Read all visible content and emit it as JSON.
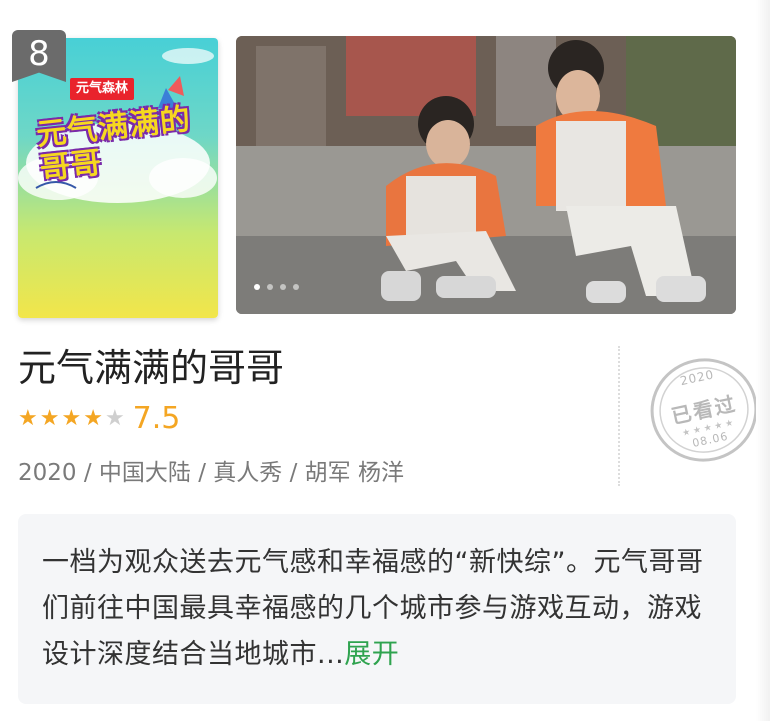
{
  "rank": {
    "number": "8"
  },
  "poster": {
    "brand_label": "元气森林",
    "title_art": "元气满满的哥哥"
  },
  "banner": {
    "dots_total": 4,
    "active_index": 0
  },
  "show": {
    "title": "元气满满的哥哥",
    "rating": {
      "stars_filled": 4,
      "stars_total": 5,
      "score": "7.5"
    },
    "meta": "2020 / 中国大陆 / 真人秀 / 胡军 杨洋"
  },
  "stamp": {
    "year": "2020",
    "label": "已看过",
    "date": "08.06"
  },
  "synopsis": {
    "text": "一档为观众送去元气感和幸福感的“新快综”。元气哥哥们前往中国最具幸福感的几个城市参与游戏互动，游戏设计深度结合当地城市...",
    "expand_label": "展开"
  },
  "colors": {
    "accent_star": "#f4a623",
    "expand_link": "#2fa34f",
    "badge": "#6b6b6b"
  }
}
